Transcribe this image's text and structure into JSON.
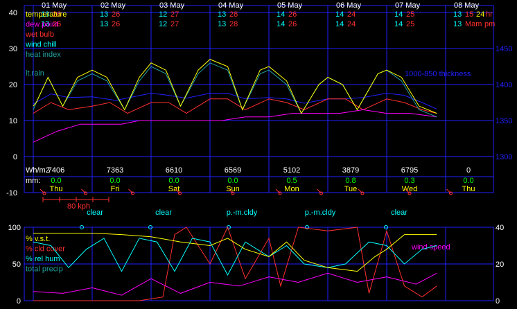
{
  "chart_data": [
    {
      "type": "line",
      "panel": "top",
      "dates": [
        "01 May",
        "02 May",
        "03 May",
        "04 May",
        "05 May",
        "06 May",
        "07 May",
        "08 May"
      ],
      "max_temps": [
        "13",
        "13",
        "12",
        "13",
        "14",
        "14",
        "14",
        "13"
      ],
      "max_temps2": [
        "26",
        "26",
        "27",
        "28",
        "26",
        "24",
        "25",
        "15"
      ],
      "min_temps": [
        "13",
        "13",
        "12",
        "13",
        "14",
        "14",
        "14",
        "13"
      ],
      "min_temps2": [
        "26",
        "26",
        "27",
        "28",
        "26",
        "24",
        "25",
        "Mam"
      ],
      "extra": {
        "hr": "24",
        "hr_label": "hr",
        "pm_label": "pm"
      },
      "legend": [
        {
          "name": "temperature",
          "color": "#ffff00"
        },
        {
          "name": "dew point",
          "color": "#ff00ff"
        },
        {
          "name": "wet bulb",
          "color": "#ff3030"
        },
        {
          "name": "wind chill",
          "color": "#00ffff"
        },
        {
          "name": "heat index",
          "color": "#20a0a0"
        }
      ],
      "left_axis": {
        "ticks": [
          "40",
          "30",
          "20",
          "10",
          "0",
          "-10"
        ],
        "values": [
          40,
          30,
          20,
          10,
          0,
          -10
        ]
      },
      "right_axis": {
        "ticks": [
          "1450",
          "1400",
          "1350",
          "1300"
        ],
        "values": [
          1450,
          1400,
          1350,
          1300
        ]
      },
      "rain_label": "lt.rain",
      "thickness_label": "1000-850 thickness",
      "temperature": [
        [
          0,
          14
        ],
        [
          0.05,
          15
        ],
        [
          0.25,
          22
        ],
        [
          0.5,
          14
        ],
        [
          0.75,
          22
        ],
        [
          1,
          24
        ],
        [
          1.25,
          22
        ],
        [
          1.55,
          13
        ],
        [
          1.8,
          22
        ],
        [
          2,
          26
        ],
        [
          2.25,
          24
        ],
        [
          2.5,
          14
        ],
        [
          2.8,
          24
        ],
        [
          3,
          27
        ],
        [
          3.3,
          25
        ],
        [
          3.55,
          13
        ],
        [
          3.85,
          24
        ],
        [
          4,
          25
        ],
        [
          4.3,
          21
        ],
        [
          4.55,
          12
        ],
        [
          4.85,
          20
        ],
        [
          5,
          22
        ],
        [
          5.25,
          20
        ],
        [
          5.5,
          13
        ],
        [
          5.85,
          23
        ],
        [
          6,
          24
        ],
        [
          6.25,
          22
        ],
        [
          6.55,
          14
        ],
        [
          6.85,
          12
        ]
      ],
      "heat_index": [
        [
          0,
          13
        ],
        [
          0.05,
          15
        ],
        [
          0.25,
          22
        ],
        [
          0.5,
          14
        ],
        [
          0.75,
          21
        ],
        [
          1,
          23
        ],
        [
          1.25,
          21
        ],
        [
          1.55,
          13
        ],
        [
          1.8,
          21
        ],
        [
          2,
          25
        ],
        [
          2.25,
          23
        ],
        [
          2.5,
          14
        ],
        [
          2.8,
          23
        ],
        [
          3,
          26
        ],
        [
          3.3,
          24
        ],
        [
          3.55,
          13
        ],
        [
          3.85,
          23
        ],
        [
          4,
          24
        ],
        [
          4.3,
          20
        ],
        [
          4.55,
          12
        ],
        [
          4.85,
          20
        ],
        [
          5,
          22
        ],
        [
          5.25,
          20
        ],
        [
          5.5,
          13
        ],
        [
          5.85,
          23
        ],
        [
          6,
          24
        ],
        [
          6.25,
          21
        ],
        [
          6.55,
          13
        ],
        [
          6.85,
          11
        ]
      ],
      "thickness": [
        [
          0,
          1373
        ],
        [
          0.3,
          1387
        ],
        [
          0.6,
          1382
        ],
        [
          1,
          1383
        ],
        [
          1.4,
          1378
        ],
        [
          1.7,
          1383
        ],
        [
          2,
          1388
        ],
        [
          2.3,
          1385
        ],
        [
          2.6,
          1381
        ],
        [
          3,
          1388
        ],
        [
          3.3,
          1388
        ],
        [
          3.6,
          1380
        ],
        [
          4,
          1382
        ],
        [
          4.3,
          1380
        ],
        [
          4.6,
          1374
        ],
        [
          5,
          1380
        ],
        [
          5.3,
          1380
        ],
        [
          5.6,
          1382
        ],
        [
          6,
          1388
        ],
        [
          6.3,
          1385
        ],
        [
          6.6,
          1375
        ],
        [
          6.85,
          1366
        ]
      ],
      "wet_bulb": [
        [
          0,
          12
        ],
        [
          0.3,
          15
        ],
        [
          0.6,
          13
        ],
        [
          1,
          14
        ],
        [
          1.3,
          15
        ],
        [
          1.6,
          12
        ],
        [
          2,
          15
        ],
        [
          2.3,
          15
        ],
        [
          2.6,
          12
        ],
        [
          3,
          16
        ],
        [
          3.3,
          16
        ],
        [
          3.6,
          13
        ],
        [
          4,
          16
        ],
        [
          4.3,
          15
        ],
        [
          4.6,
          13
        ],
        [
          5,
          16
        ],
        [
          5.3,
          16
        ],
        [
          5.6,
          13
        ],
        [
          6,
          16
        ],
        [
          6.3,
          15
        ],
        [
          6.6,
          13
        ],
        [
          6.85,
          12
        ]
      ],
      "dew_point": [
        [
          0,
          4
        ],
        [
          0.4,
          7
        ],
        [
          0.8,
          9
        ],
        [
          1,
          9
        ],
        [
          1.5,
          9
        ],
        [
          1.8,
          10
        ],
        [
          2.2,
          10
        ],
        [
          2.8,
          10
        ],
        [
          3.2,
          10
        ],
        [
          3.6,
          11
        ],
        [
          4,
          11
        ],
        [
          4.4,
          12
        ],
        [
          4.8,
          12
        ],
        [
          5.2,
          12
        ],
        [
          5.6,
          13
        ],
        [
          6,
          12
        ],
        [
          6.4,
          12
        ],
        [
          6.85,
          11
        ]
      ],
      "data_rows": {
        "wh_label": "Wh/m2",
        "mm_label": "mm:",
        "wh": [
          "7406",
          "7363",
          "6610",
          "6569",
          "5102",
          "3879",
          "6795",
          "0"
        ],
        "mm": [
          "0.0",
          "0.0",
          "0.0",
          "0.0",
          "0.5",
          "0.8",
          "0.3",
          "0.0"
        ],
        "days": [
          "Thu",
          "Fri",
          "Sat",
          "Sun",
          "Mon",
          "Tue",
          "Wed",
          "Thu"
        ]
      },
      "wind_scale_label": "80 kph"
    },
    {
      "type": "line",
      "panel": "bottom",
      "sky": [
        "clear",
        "clear",
        "p.-m.cldy",
        "p.-m.cldy",
        "clear"
      ],
      "left_axis": {
        "ticks": [
          "100",
          "50",
          "0"
        ],
        "values": [
          100,
          50,
          0
        ]
      },
      "right_axis": {
        "ticks": [
          "40",
          "20",
          "0"
        ],
        "values": [
          40,
          20,
          0
        ]
      },
      "legend": [
        {
          "name": "% v.s.t.",
          "color": "#ffff00"
        },
        {
          "name": "% cld cover",
          "color": "#ff3030"
        },
        {
          "name": "% rel hum",
          "color": "#00ffff"
        },
        {
          "name": "total precip",
          "color": "#20a0a0"
        },
        {
          "name": "wind speed",
          "color": "#ff00ff"
        }
      ],
      "vst": [
        [
          0,
          92
        ],
        [
          1,
          92
        ],
        [
          1.5,
          90
        ],
        [
          2,
          87
        ],
        [
          2.5,
          80
        ],
        [
          3,
          75
        ],
        [
          3.3,
          85
        ],
        [
          3.6,
          70
        ],
        [
          4,
          60
        ],
        [
          4.3,
          80
        ],
        [
          4.6,
          55
        ],
        [
          5,
          45
        ],
        [
          5.5,
          40
        ],
        [
          5.8,
          60
        ],
        [
          6,
          70
        ],
        [
          6.3,
          90
        ],
        [
          6.85,
          90
        ]
      ],
      "cloud": [
        [
          0,
          0
        ],
        [
          1,
          0
        ],
        [
          1.8,
          0
        ],
        [
          2.2,
          5
        ],
        [
          2.4,
          90
        ],
        [
          2.6,
          100
        ],
        [
          3,
          50
        ],
        [
          3.3,
          100
        ],
        [
          3.6,
          30
        ],
        [
          4,
          85
        ],
        [
          4.2,
          20
        ],
        [
          4.5,
          100
        ],
        [
          5,
          95
        ],
        [
          5.5,
          100
        ],
        [
          5.7,
          10
        ],
        [
          6,
          95
        ],
        [
          6.3,
          20
        ],
        [
          6.6,
          5
        ],
        [
          6.85,
          20
        ]
      ],
      "rel_hum": [
        [
          0,
          80
        ],
        [
          0.3,
          75
        ],
        [
          0.6,
          45
        ],
        [
          0.9,
          70
        ],
        [
          1.2,
          85
        ],
        [
          1.5,
          40
        ],
        [
          1.8,
          85
        ],
        [
          2.1,
          80
        ],
        [
          2.4,
          40
        ],
        [
          2.7,
          85
        ],
        [
          3,
          80
        ],
        [
          3.3,
          35
        ],
        [
          3.6,
          80
        ],
        [
          4,
          60
        ],
        [
          4.3,
          75
        ],
        [
          4.6,
          50
        ],
        [
          5,
          45
        ],
        [
          5.3,
          50
        ],
        [
          5.7,
          80
        ],
        [
          6,
          75
        ],
        [
          6.3,
          50
        ],
        [
          6.6,
          70
        ],
        [
          6.85,
          75
        ]
      ],
      "wind": [
        [
          0,
          5
        ],
        [
          0.5,
          4
        ],
        [
          1,
          7
        ],
        [
          1.5,
          3
        ],
        [
          2,
          12
        ],
        [
          2.5,
          4
        ],
        [
          3,
          10
        ],
        [
          3.5,
          8
        ],
        [
          4,
          13
        ],
        [
          4.5,
          10
        ],
        [
          5,
          15
        ],
        [
          5.5,
          10
        ],
        [
          6,
          13
        ],
        [
          6.5,
          9
        ],
        [
          6.85,
          15
        ]
      ]
    }
  ]
}
